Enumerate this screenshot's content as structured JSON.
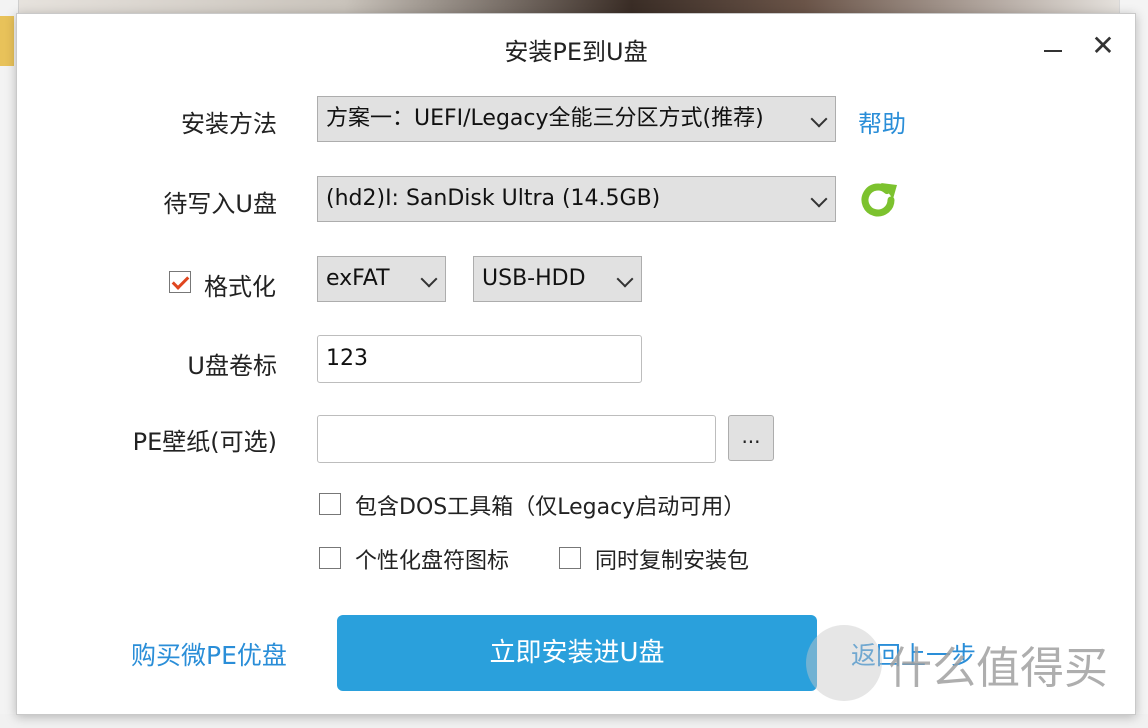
{
  "window": {
    "title": "安装PE到U盘",
    "minimize_icon": "minimize-icon",
    "close_label": "✕"
  },
  "install_method": {
    "label": "安装方法",
    "value": "方案一：UEFI/Legacy全能三分区方式(推荐)",
    "help_link": "帮助"
  },
  "target_drive": {
    "label": "待写入U盘",
    "value": "(hd2)I: SanDisk Ultra (14.5GB)",
    "refresh_icon": "refresh-icon"
  },
  "format": {
    "checkbox_label": "格式化",
    "checked": true,
    "filesystem": "exFAT",
    "mode": "USB-HDD"
  },
  "volume_label": {
    "label": "U盘卷标",
    "value": "123"
  },
  "wallpaper": {
    "label": "PE壁纸(可选)",
    "value": "",
    "browse_label": "..."
  },
  "options": {
    "dos_tools": {
      "label": "包含DOS工具箱（仅Legacy启动可用）",
      "checked": false
    },
    "custom_icon": {
      "label": "个性化盘符图标",
      "checked": false
    },
    "copy_package": {
      "label": "同时复制安装包",
      "checked": false
    }
  },
  "footer": {
    "buy_link": "购买微PE优盘",
    "install_button": "立即安装进U盘",
    "back_link": "返回上一步"
  },
  "watermark": {
    "text": "什么值得买",
    "logo_char": "值"
  },
  "colors": {
    "accent": "#2aa0dc",
    "link": "#2a8ed8",
    "check": "#e0461f",
    "refresh": "#7cc22e"
  }
}
